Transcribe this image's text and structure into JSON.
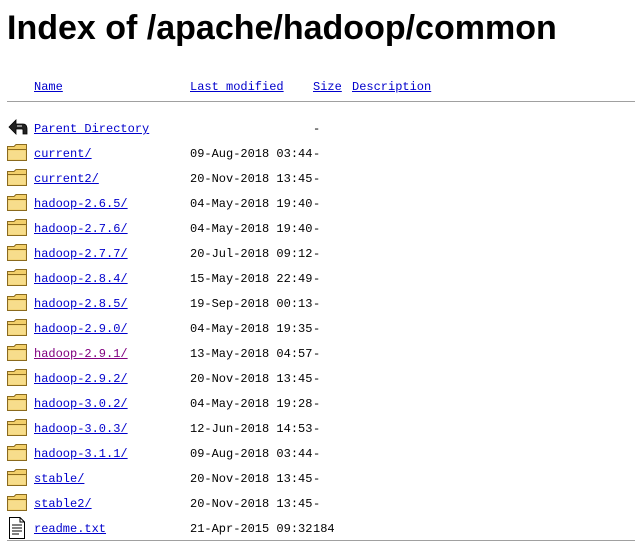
{
  "page": {
    "title": "Index of /apache/hadoop/common"
  },
  "columns": {
    "name": "Name",
    "last_modified": "Last modified",
    "size": "Size",
    "description": "Description"
  },
  "rows": [
    {
      "icon": "back-icon",
      "name": "Parent Directory",
      "date": "",
      "size": "-",
      "desc": "",
      "visited": false
    },
    {
      "icon": "folder-icon",
      "name": "current/",
      "date": "09-Aug-2018 03:44",
      "size": "-",
      "desc": "",
      "visited": false
    },
    {
      "icon": "folder-icon",
      "name": "current2/",
      "date": "20-Nov-2018 13:45",
      "size": "-",
      "desc": "",
      "visited": false
    },
    {
      "icon": "folder-icon",
      "name": "hadoop-2.6.5/",
      "date": "04-May-2018 19:40",
      "size": "-",
      "desc": "",
      "visited": false
    },
    {
      "icon": "folder-icon",
      "name": "hadoop-2.7.6/",
      "date": "04-May-2018 19:40",
      "size": "-",
      "desc": "",
      "visited": false
    },
    {
      "icon": "folder-icon",
      "name": "hadoop-2.7.7/",
      "date": "20-Jul-2018 09:12",
      "size": "-",
      "desc": "",
      "visited": false
    },
    {
      "icon": "folder-icon",
      "name": "hadoop-2.8.4/",
      "date": "15-May-2018 22:49",
      "size": "-",
      "desc": "",
      "visited": false
    },
    {
      "icon": "folder-icon",
      "name": "hadoop-2.8.5/",
      "date": "19-Sep-2018 00:13",
      "size": "-",
      "desc": "",
      "visited": false
    },
    {
      "icon": "folder-icon",
      "name": "hadoop-2.9.0/",
      "date": "04-May-2018 19:35",
      "size": "-",
      "desc": "",
      "visited": false
    },
    {
      "icon": "folder-icon",
      "name": "hadoop-2.9.1/",
      "date": "13-May-2018 04:57",
      "size": "-",
      "desc": "",
      "visited": true
    },
    {
      "icon": "folder-icon",
      "name": "hadoop-2.9.2/",
      "date": "20-Nov-2018 13:45",
      "size": "-",
      "desc": "",
      "visited": false
    },
    {
      "icon": "folder-icon",
      "name": "hadoop-3.0.2/",
      "date": "04-May-2018 19:28",
      "size": "-",
      "desc": "",
      "visited": false
    },
    {
      "icon": "folder-icon",
      "name": "hadoop-3.0.3/",
      "date": "12-Jun-2018 14:53",
      "size": "-",
      "desc": "",
      "visited": false
    },
    {
      "icon": "folder-icon",
      "name": "hadoop-3.1.1/",
      "date": "09-Aug-2018 03:44",
      "size": "-",
      "desc": "",
      "visited": false
    },
    {
      "icon": "folder-icon",
      "name": "stable/",
      "date": "20-Nov-2018 13:45",
      "size": "-",
      "desc": "",
      "visited": false
    },
    {
      "icon": "folder-icon",
      "name": "stable2/",
      "date": "20-Nov-2018 13:45",
      "size": "-",
      "desc": "",
      "visited": false
    },
    {
      "icon": "text-file-icon",
      "name": "readme.txt",
      "date": "21-Apr-2015 09:32",
      "size": "184",
      "desc": "",
      "visited": false
    }
  ],
  "colors": {
    "link": "#0000cc",
    "visited_link": "#800080",
    "folder_fill": "#f2cf6b",
    "folder_stroke": "#8a6a1e",
    "rule": "#a0a0a0"
  }
}
